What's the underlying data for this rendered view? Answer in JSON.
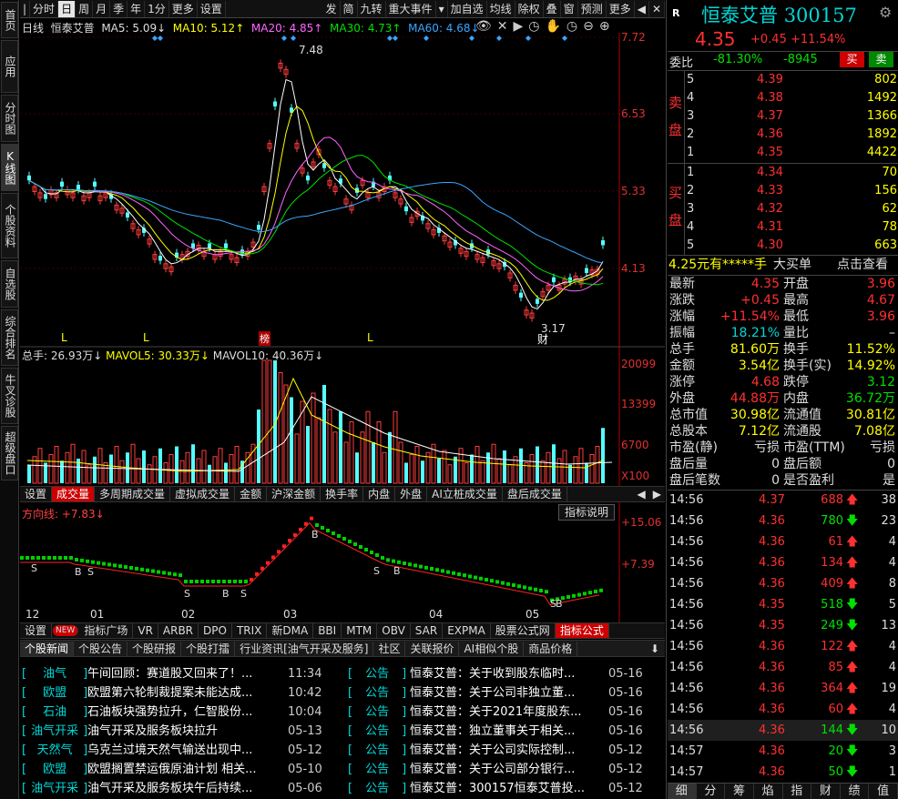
{
  "leftnav": [
    {
      "label": "首页"
    },
    {
      "label": "应用"
    },
    {
      "label": "分时图"
    },
    {
      "label": "K线图"
    },
    {
      "label": "个股资料"
    },
    {
      "label": "自选股"
    },
    {
      "label": "综合排名"
    },
    {
      "label": "牛叉诊股"
    },
    {
      "label": "超级盘口"
    }
  ],
  "toolbar": {
    "left": [
      "分时",
      "日",
      "周",
      "月",
      "季",
      "年",
      "1分",
      "更多",
      "设置"
    ],
    "mid": [
      "发",
      "简",
      "九转",
      "重大事件"
    ],
    "right": [
      "加自选",
      "均线",
      "除权",
      "叠",
      "窗",
      "预测",
      "更多"
    ]
  },
  "kline": {
    "period": "日线",
    "name": "恒泰艾普",
    "ma5": "MA5: 5.09↓",
    "ma10": "MA10: 5.12↑",
    "ma20": "MA20: 4.85↑",
    "ma30": "MA30: 4.73↑",
    "ma60": "MA60: 4.68↓",
    "yaxis": [
      "7.72",
      "6.53",
      "5.33",
      "4.13"
    ],
    "high_label": "7.48",
    "low_label": "3.17",
    "markers": [
      "L",
      "L",
      "榜",
      "L",
      "财"
    ]
  },
  "volume": {
    "total": "总手: 26.93万↓",
    "mavol5": "MAVOL5: 30.33万↓",
    "mavol10": "MAVOL10: 40.36万↓",
    "yaxis": [
      "20099",
      "13399",
      "6700",
      "X100"
    ]
  },
  "voltabs": [
    "设置",
    "成交量",
    "多周期成交量",
    "虚拟成交量",
    "金额",
    "沪深金额",
    "换手率",
    "内盘",
    "外盘",
    "AI立桩成交量",
    "盘后成交量"
  ],
  "indicator": {
    "label": "方向线: +7.83↓",
    "explain": "指标说明",
    "yaxis": [
      "+15.06",
      "+7.39"
    ],
    "xaxis": [
      "12",
      "01",
      "02",
      "03",
      "04",
      "05"
    ],
    "signals": [
      "S",
      "B",
      "S",
      "S",
      "B",
      "S",
      "B",
      "S",
      "B",
      "S",
      "B"
    ]
  },
  "indtabs": [
    "设置",
    "NEW",
    "指标广场",
    "VR",
    "ARBR",
    "DPO",
    "TRIX",
    "新DMA",
    "BBI",
    "MTM",
    "OBV",
    "SAR",
    "EXPMA",
    "股票公式网",
    "指标公式"
  ],
  "newstabs": [
    "个股新闻",
    "个股公告",
    "个股研报",
    "个股打擂",
    "行业资讯[油气开采及服务]",
    "社区",
    "关联报价",
    "AI相似个股",
    "商品价格"
  ],
  "news_left": [
    {
      "tag": "油气",
      "title": "午间回顾：赛道股又回来了！...",
      "time": "11:34"
    },
    {
      "tag": "欧盟",
      "title": "欧盟第六轮制裁提案未能达成...",
      "time": "10:42"
    },
    {
      "tag": "石油",
      "title": "石油板块强势拉升，仁智股份...",
      "time": "10:04"
    },
    {
      "tag": "油气开采",
      "title": "油气开采及服务板块拉升",
      "time": "05-13"
    },
    {
      "tag": "天然气",
      "title": "乌克兰过境天然气输送出现中...",
      "time": "05-12"
    },
    {
      "tag": "欧盟",
      "title": "欧盟搁置禁运俄原油计划 相关...",
      "time": "05-10"
    },
    {
      "tag": "油气开采",
      "title": "油气开采及服务板块午后持续...",
      "time": "05-06"
    }
  ],
  "news_right": [
    {
      "tag": "公告",
      "title": "恒泰艾普：关于收到股东临时...",
      "time": "05-16"
    },
    {
      "tag": "公告",
      "title": "恒泰艾普：关于公司非独立董...",
      "time": "05-16"
    },
    {
      "tag": "公告",
      "title": "恒泰艾普：关于2021年度股东...",
      "time": "05-16"
    },
    {
      "tag": "公告",
      "title": "恒泰艾普：独立董事关于相关...",
      "time": "05-16"
    },
    {
      "tag": "公告",
      "title": "恒泰艾普：关于公司实际控制...",
      "time": "05-12"
    },
    {
      "tag": "公告",
      "title": "恒泰艾普：关于公司部分银行...",
      "time": "05-12"
    },
    {
      "tag": "公告",
      "title": "恒泰艾普：300157恒泰艾普投...",
      "time": "05-12"
    }
  ],
  "quote": {
    "r": "R",
    "name": "恒泰艾普",
    "code": "300157",
    "price": "4.35",
    "change": "+0.45",
    "pct": "+11.54%",
    "weibi_label": "委比",
    "weibi": "-81.30%",
    "weicha": "-8945",
    "buy_btn": "买",
    "sell_btn": "卖",
    "sell_label": "卖 盘",
    "buy_label": "买 盘",
    "asks": [
      {
        "lvl": "5",
        "p": "4.39",
        "v": "802"
      },
      {
        "lvl": "4",
        "p": "4.38",
        "v": "1492"
      },
      {
        "lvl": "3",
        "p": "4.37",
        "v": "1366"
      },
      {
        "lvl": "2",
        "p": "4.36",
        "v": "1892"
      },
      {
        "lvl": "1",
        "p": "4.35",
        "v": "4422"
      }
    ],
    "bids": [
      {
        "lvl": "1",
        "p": "4.34",
        "v": "70"
      },
      {
        "lvl": "2",
        "p": "4.33",
        "v": "156"
      },
      {
        "lvl": "3",
        "p": "4.32",
        "v": "62"
      },
      {
        "lvl": "4",
        "p": "4.31",
        "v": "78"
      },
      {
        "lvl": "5",
        "p": "4.30",
        "v": "663"
      }
    ],
    "bigorder": {
      "price": "4.25元有",
      "hand": "*****手",
      "label": "大买单",
      "link": "点击查看"
    },
    "stats": [
      [
        "最新",
        "4.35",
        "开盘",
        "3.96"
      ],
      [
        "涨跌",
        "+0.45",
        "最高",
        "4.67"
      ],
      [
        "涨幅",
        "+11.54%",
        "最低",
        "3.96"
      ],
      [
        "振幅",
        "18.21%",
        "量比",
        "–"
      ],
      [
        "总手",
        "81.60万",
        "换手",
        "11.52%"
      ],
      [
        "金额",
        "3.54亿",
        "换手(实)",
        "14.92%"
      ],
      [
        "涨停",
        "4.68",
        "跌停",
        "3.12"
      ],
      [
        "外盘",
        "44.88万",
        "内盘",
        "36.72万"
      ],
      [
        "总市值",
        "30.98亿",
        "流通值",
        "30.81亿"
      ],
      [
        "总股本",
        "7.12亿",
        "流通股",
        "7.08亿"
      ],
      [
        "市盈(静)",
        "亏损",
        "市盈(TTM)",
        "亏损"
      ],
      [
        "盘后量",
        "0",
        "盘后额",
        "0"
      ],
      [
        "盘后笔数",
        "0",
        "是否盈利",
        "是"
      ]
    ]
  },
  "ticks": [
    {
      "t": "14:56",
      "p": "4.37",
      "v": "688",
      "d": "up",
      "n": "38"
    },
    {
      "t": "14:56",
      "p": "4.36",
      "v": "780",
      "d": "down",
      "n": "23"
    },
    {
      "t": "14:56",
      "p": "4.36",
      "v": "61",
      "d": "up",
      "n": "4"
    },
    {
      "t": "14:56",
      "p": "4.36",
      "v": "134",
      "d": "up",
      "n": "4"
    },
    {
      "t": "14:56",
      "p": "4.36",
      "v": "409",
      "d": "up",
      "n": "8"
    },
    {
      "t": "14:56",
      "p": "4.35",
      "v": "518",
      "d": "down",
      "n": "5"
    },
    {
      "t": "14:56",
      "p": "4.35",
      "v": "249",
      "d": "down",
      "n": "13"
    },
    {
      "t": "14:56",
      "p": "4.36",
      "v": "122",
      "d": "up",
      "n": "4"
    },
    {
      "t": "14:56",
      "p": "4.36",
      "v": "85",
      "d": "up",
      "n": "4"
    },
    {
      "t": "14:56",
      "p": "4.36",
      "v": "364",
      "d": "up",
      "n": "19"
    },
    {
      "t": "14:56",
      "p": "4.36",
      "v": "60",
      "d": "up",
      "n": "4"
    },
    {
      "t": "14:56",
      "p": "4.36",
      "v": "144",
      "d": "down",
      "n": "10"
    },
    {
      "t": "14:57",
      "p": "4.36",
      "v": "20",
      "d": "down",
      "n": "3"
    },
    {
      "t": "14:57",
      "p": "4.36",
      "v": "50",
      "d": "down",
      "n": "1"
    }
  ],
  "bottomtabs": [
    "细",
    "分",
    "筹",
    "焰",
    "指",
    "财",
    "绩",
    "值"
  ]
}
